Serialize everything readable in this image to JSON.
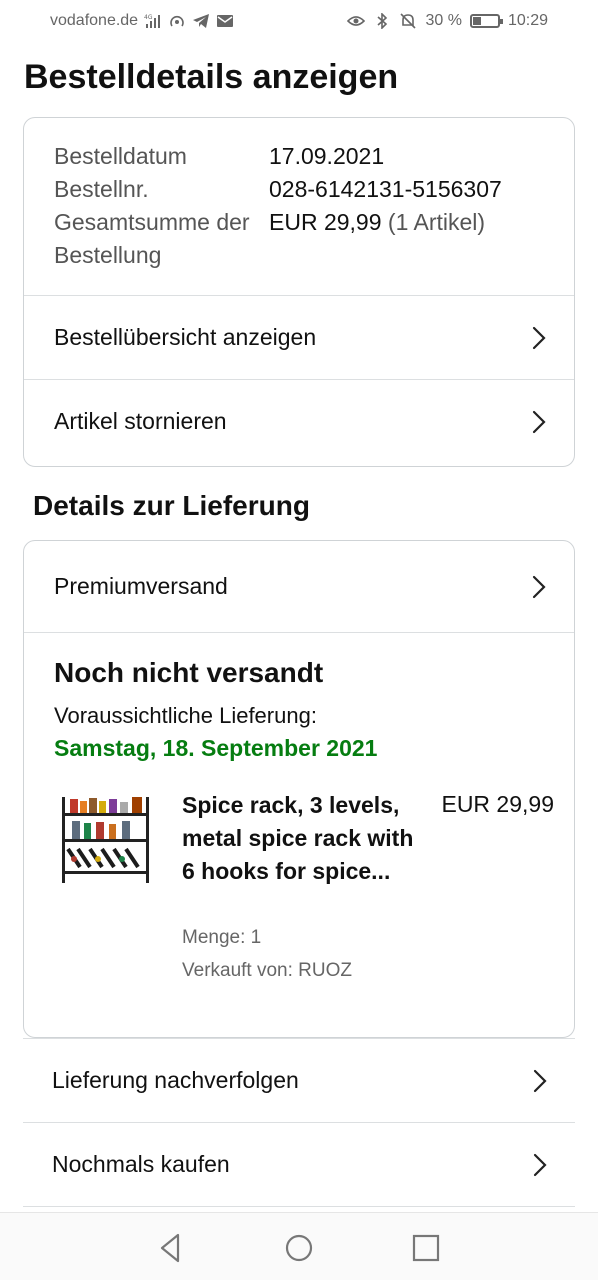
{
  "status_bar": {
    "carrier": "vodafone.de",
    "network": "4G",
    "battery_percent": "30 %",
    "battery_level": 0.3,
    "time": "10:29",
    "icons": [
      "signal-icon",
      "hotspot-icon",
      "telegram-icon",
      "mail-icon",
      "eye-icon",
      "bluetooth-icon",
      "mute-icon",
      "battery-icon"
    ]
  },
  "page": {
    "title": "Bestelldetails anzeigen"
  },
  "order": {
    "date_label": "Bestelldatum",
    "date_value": "17.09.2021",
    "number_label": "Bestellnr.",
    "number_value": "028-6142131-5156307",
    "total_label": "Gesamtsumme der Bestellung",
    "total_value": "EUR 29,99",
    "total_items": "(1 Artikel)",
    "summary_link": "Bestellübersicht anzeigen",
    "cancel_link": "Artikel stornieren"
  },
  "delivery": {
    "section_title": "Details zur Lieferung",
    "shipping_method": "Premiumversand",
    "status": "Noch nicht versandt",
    "eta_label": "Voraussichtliche Lieferung:",
    "eta_date": "Samstag, 18. September 2021",
    "eta_color": "#067d11"
  },
  "product": {
    "title": "Spice rack, 3 levels, metal spice rack with 6 hooks for spice...",
    "price": "EUR 29,99",
    "quantity": "Menge: 1",
    "seller": "Verkauft von: RUOZ"
  },
  "actions": {
    "track": "Lieferung nachverfolgen",
    "buy_again": "Nochmals kaufen"
  },
  "nav": {
    "icons": [
      "back-icon",
      "home-icon",
      "recents-icon"
    ]
  }
}
